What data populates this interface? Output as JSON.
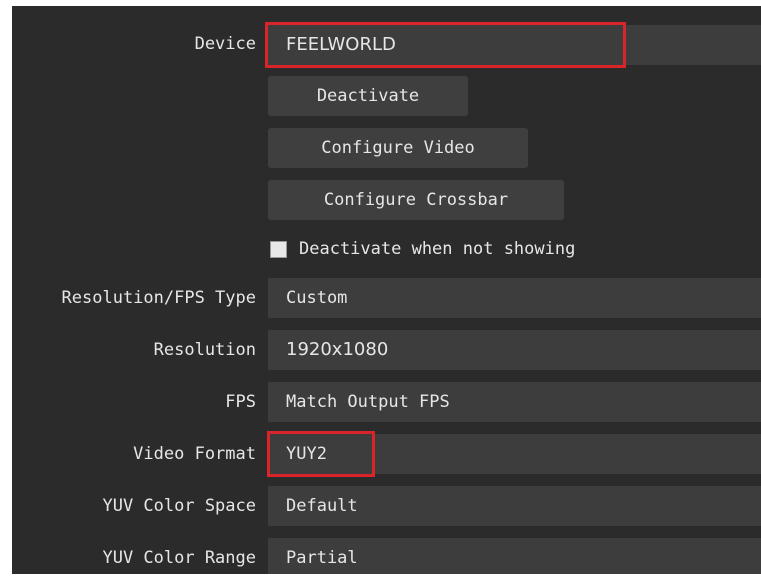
{
  "device": {
    "label": "Device",
    "value": "FEELWORLD"
  },
  "buttons": {
    "deactivate": "Deactivate",
    "configure_video": "Configure Video",
    "configure_crossbar": "Configure Crossbar"
  },
  "deactivate_when_not_showing": {
    "label": "Deactivate when not showing",
    "checked": false
  },
  "resolution_fps_type": {
    "label": "Resolution/FPS Type",
    "value": "Custom"
  },
  "resolution": {
    "label": "Resolution",
    "value": "1920x1080"
  },
  "fps": {
    "label": "FPS",
    "value": "Match Output FPS"
  },
  "video_format": {
    "label": "Video Format",
    "value": "YUY2"
  },
  "yuv_color_space": {
    "label": "YUV Color Space",
    "value": "Default"
  },
  "yuv_color_range": {
    "label": "YUV Color Range",
    "value": "Partial"
  },
  "colors": {
    "background": "#2b2b2b",
    "field": "#3d3d3d",
    "highlight": "#d9252a"
  }
}
